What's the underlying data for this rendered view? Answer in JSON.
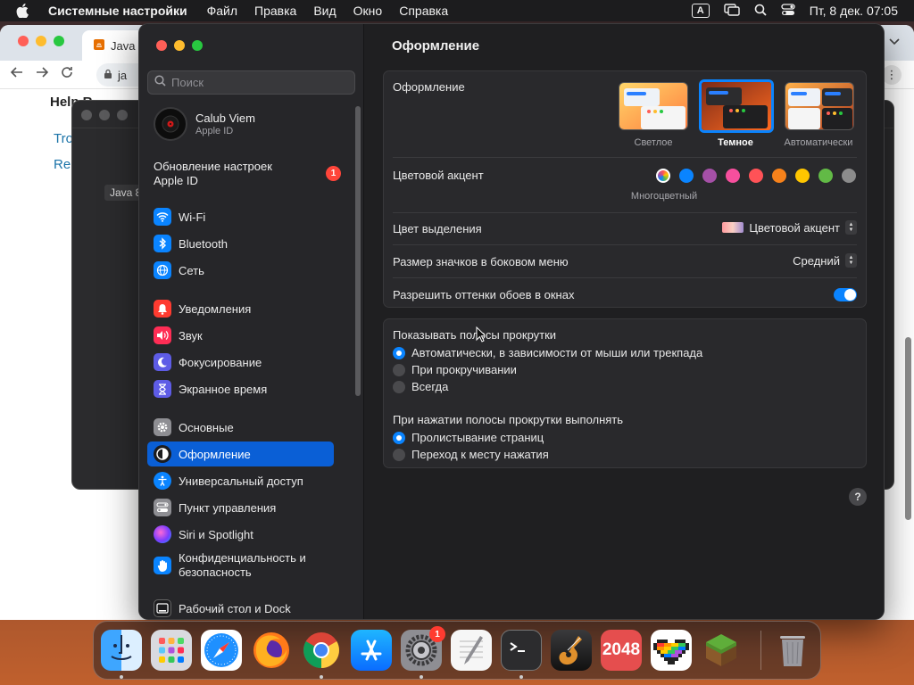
{
  "menubar": {
    "app_name": "Системные настройки",
    "items": [
      "Файл",
      "Правка",
      "Вид",
      "Окно",
      "Справка"
    ],
    "input_source": "A",
    "datetime": "Пт, 8 дек.  07:05"
  },
  "browser": {
    "tab_title": "Java",
    "url_text": "ja",
    "page_lines": [
      "Help R",
      "Tro",
      "Re"
    ]
  },
  "java_window": {
    "label": "Java 8"
  },
  "sidebar": {
    "search_placeholder": "Поиск",
    "profile": {
      "name": "Calub Viem",
      "subtitle": "Apple ID"
    },
    "update": {
      "text": "Обновление настроек Apple ID",
      "badge": "1"
    },
    "items": [
      {
        "label": "Wi-Fi",
        "icon": "wifi-icon",
        "color": "#0a84ff"
      },
      {
        "label": "Bluetooth",
        "icon": "bluetooth-icon",
        "color": "#0a84ff"
      },
      {
        "label": "Сеть",
        "icon": "globe-icon",
        "color": "#0a84ff"
      },
      {
        "label": "Уведомления",
        "icon": "bell-icon",
        "color": "#ff3b30"
      },
      {
        "label": "Звук",
        "icon": "speaker-icon",
        "color": "#ff2d55"
      },
      {
        "label": "Фокусирование",
        "icon": "moon-icon",
        "color": "#5e5ce6"
      },
      {
        "label": "Экранное время",
        "icon": "hourglass-icon",
        "color": "#5e5ce6"
      },
      {
        "label": "Основные",
        "icon": "gear-icon",
        "color": "#8e8e93"
      },
      {
        "label": "Оформление",
        "icon": "appearance-icon",
        "color": "#1c1c1e"
      },
      {
        "label": "Универсальный доступ",
        "icon": "accessibility-icon",
        "color": "#0a84ff"
      },
      {
        "label": "Пункт управления",
        "icon": "control-center-icon",
        "color": "#8e8e93"
      },
      {
        "label": "Siri и Spotlight",
        "icon": "siri-icon",
        "color": "#bf5af2"
      },
      {
        "label": "Конфиденциальность и безопасность",
        "icon": "hand-icon",
        "color": "#0a84ff"
      },
      {
        "label": "Рабочий стол и Dock",
        "icon": "dock-icon",
        "color": "#1c1c1e"
      }
    ]
  },
  "content": {
    "title": "Оформление",
    "appearance": {
      "label": "Оформление",
      "options": [
        "Светлое",
        "Темное",
        "Автоматически"
      ],
      "selected": "Темное"
    },
    "accent": {
      "label": "Цветовой акцент",
      "caption": "Многоцветный",
      "colors": [
        "#multicolor",
        "#0a84ff",
        "#a550a7",
        "#f74f9e",
        "#ff5257",
        "#f7821b",
        "#ffc600",
        "#62ba46",
        "#8c8c8c"
      ]
    },
    "highlight": {
      "label": "Цвет выделения",
      "value": "Цветовой акцент"
    },
    "sidebar_icon_size": {
      "label": "Размер значков в боковом меню",
      "value": "Средний"
    },
    "wallpaper_tinting": {
      "label": "Разрешить оттенки обоев в окнах",
      "enabled": true
    },
    "scrollbars": {
      "label": "Показывать полосы прокрутки",
      "options": [
        "Автоматически, в зависимости от мыши или трекпада",
        "При прокручивании",
        "Всегда"
      ],
      "selected": 0
    },
    "click_scrollbar": {
      "label": "При нажатии полосы прокрутки выполнять",
      "options": [
        "Пролистывание страниц",
        "Переход к месту нажатия"
      ],
      "selected": 0
    },
    "help": "?"
  },
  "dock": {
    "apps": [
      "Finder",
      "Launchpad",
      "Safari",
      "Firefox",
      "Chrome",
      "App Store",
      "Системные настройки",
      "TextEdit",
      "Терминал",
      "GarageBand",
      "2048",
      "Pixel Heart",
      "Minecraft"
    ],
    "settings_badge": "1",
    "game_2048_label": "2048",
    "trash": "Корзина"
  }
}
